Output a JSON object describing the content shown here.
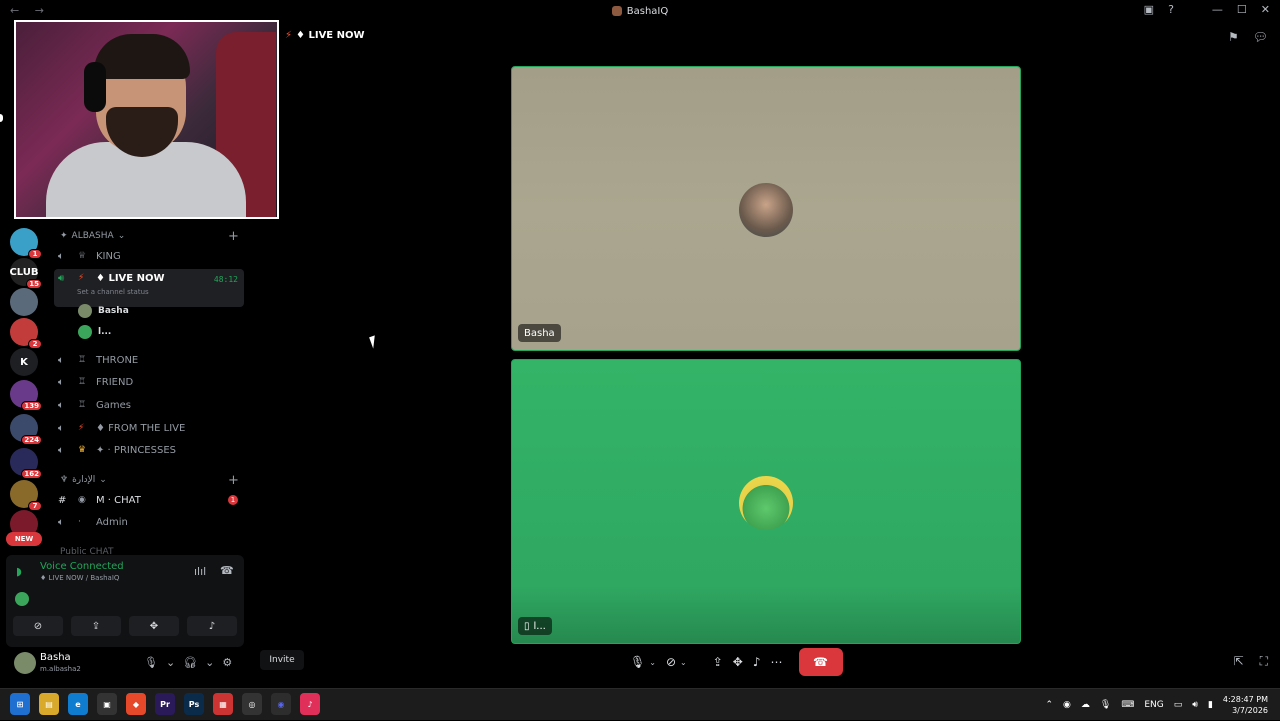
{
  "window": {
    "title": "BashaIQ",
    "nav_arrows": "← →",
    "controls": [
      "▣",
      "?",
      "—",
      "☐",
      "✕"
    ]
  },
  "stage": {
    "channel_title": "♦ LIVE NOW",
    "bolt": "⚡",
    "tiles": [
      {
        "label": "Basha"
      },
      {
        "label": "l..."
      }
    ]
  },
  "rail": {
    "servers": [
      {
        "badge": "1",
        "color": "#3aa0c8"
      },
      {
        "badge": "15",
        "color": "#222222",
        "text": "CLUB"
      },
      {
        "badge": "",
        "color": "#5b6a7a"
      },
      {
        "badge": "2",
        "color": "#c23c3c"
      },
      {
        "badge": "",
        "color": "#1e1f22",
        "text": "K"
      },
      {
        "badge": "139",
        "color": "#6a3a8a"
      },
      {
        "badge": "224",
        "color": "#3b4a6a"
      },
      {
        "badge": "162",
        "color": "#2a2a5a"
      },
      {
        "badge": "7",
        "color": "#8a6a2a"
      },
      {
        "badge": "",
        "color": "#7a1a2a"
      }
    ],
    "new_label": "NEW"
  },
  "channels": {
    "category1": "ALBASHA",
    "category2": "الإدارة",
    "category3": "Public CHAT",
    "items": [
      {
        "name": "KING",
        "emoji": "♕"
      },
      {
        "name": "♦ LIVE NOW",
        "emoji": "⚡",
        "timer": "48:12",
        "status": "Set a channel status"
      },
      {
        "name": "THRONE",
        "emoji": "♖"
      },
      {
        "name": "FRIEND",
        "emoji": "♖"
      },
      {
        "name": "Games",
        "emoji": "♖"
      },
      {
        "name": "♦ FROM THE LIVE",
        "emoji": "⚡"
      },
      {
        "name": "✦ · PRINCESSES",
        "emoji": "♛"
      },
      {
        "name": "M · CHAT",
        "emoji": "◉",
        "unread": "1"
      },
      {
        "name": "Admin",
        "emoji": "·"
      }
    ],
    "members": [
      "Basha",
      "l..."
    ]
  },
  "voice_panel": {
    "title": "Voice Connected",
    "subtitle": "♦ LIVE NOW / BashaIQ"
  },
  "user": {
    "name": "Basha",
    "handle": "m.albasha2"
  },
  "invite_label": "Invite",
  "taskbar": {
    "lang": "ENG",
    "time": "4:28:47 PM",
    "date": "3/7/2026"
  }
}
